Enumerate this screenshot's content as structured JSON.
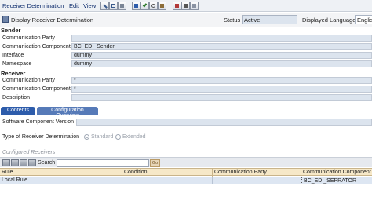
{
  "menu": {
    "items": [
      "Receiver Determination",
      "Edit",
      "View"
    ]
  },
  "toolbar": {
    "buttons": [
      "edit-icon",
      "copy-icon",
      "display-icon",
      "info-icon",
      "check-icon",
      "where-used-icon",
      "history-icon",
      "delete-icon"
    ]
  },
  "header": {
    "title": "Display Receiver Determination",
    "status_label": "Status",
    "status_value": "Active",
    "language_label": "Displayed Language",
    "language_value": "English"
  },
  "sender": {
    "heading": "Sender",
    "fields": [
      {
        "label": "Communication Party",
        "value": ""
      },
      {
        "label": "Communication Component",
        "value": "BC_EDI_Sender"
      },
      {
        "label": "Interface",
        "value": "dummy"
      },
      {
        "label": "Namespace",
        "value": "dummy"
      }
    ]
  },
  "receiver": {
    "heading": "Receiver",
    "fields": [
      {
        "label": "Communication Party",
        "value": "*"
      },
      {
        "label": "Communication Component",
        "value": "*"
      },
      {
        "label": "Description",
        "value": ""
      }
    ]
  },
  "tabs": [
    "Contents",
    "Configuration Overview"
  ],
  "contents": {
    "swcv_label": "Software Component Version",
    "swcv_value": "",
    "type_label": "Type of Receiver Determination",
    "type_options": [
      "Standard",
      "Extended"
    ],
    "type_selected": "Standard"
  },
  "configured": {
    "heading": "Configured Receivers",
    "search_label": "Search",
    "search_value": "",
    "go_label": "Go"
  },
  "grid": {
    "columns": [
      "Rule",
      "Condition",
      "Communication Party",
      "Communication Component"
    ],
    "rows": [
      [
        "Local Rule",
        "",
        "",
        "BC_EDI_SEPRATOR"
      ]
    ]
  },
  "colors": {
    "tab_active": "#2d5cab",
    "tab_inactive": "#567ab8",
    "grid_header": "#f6e8c8",
    "field_readonly": "#dce4ee"
  }
}
